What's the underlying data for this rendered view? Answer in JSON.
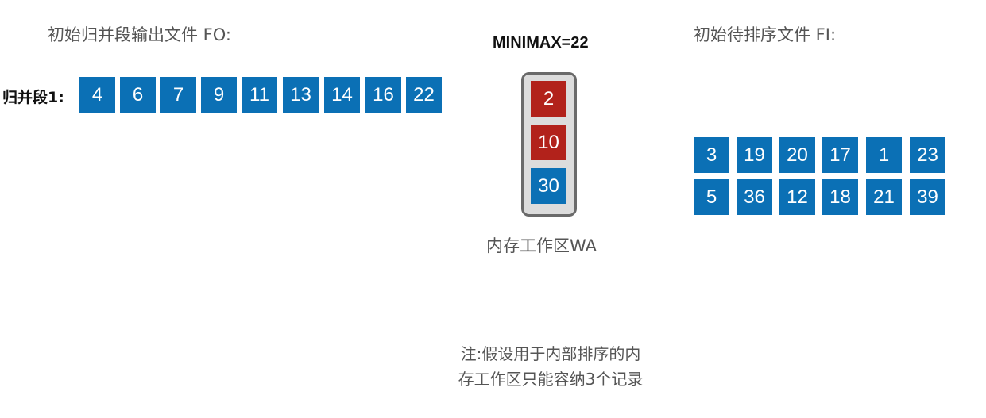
{
  "fo_label": "初始归并段输出文件 FO:",
  "fi_label": "初始待排序文件 FI:",
  "segment_label": "归并段1:",
  "segment1": [
    "4",
    "6",
    "7",
    "9",
    "11",
    "13",
    "14",
    "16",
    "22"
  ],
  "minimax": "MINIMAX=22",
  "wa_items": [
    {
      "value": "2",
      "color": "#b2221b"
    },
    {
      "value": "10",
      "color": "#b2221b"
    },
    {
      "value": "30",
      "color": "#0b70b5"
    }
  ],
  "wa_label": "内存工作区WA",
  "fi_rows": [
    [
      "3",
      "19",
      "20",
      "17",
      "1",
      "23"
    ],
    [
      "5",
      "36",
      "12",
      "18",
      "21",
      "39"
    ]
  ],
  "note_lines": [
    "注:假设用于内部排序的内",
    "存工作区只能容纳3个记录"
  ]
}
